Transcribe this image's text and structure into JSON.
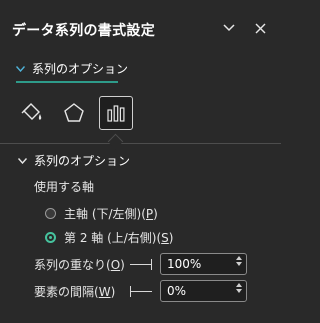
{
  "pane": {
    "title": "データ系列の書式設定",
    "collapse_icon": "chevron-down-icon",
    "close_icon": "close-icon"
  },
  "tab": {
    "label": "系列のオプション",
    "accent_color": "#2e9b8a"
  },
  "icon_tabs": [
    {
      "name": "fill-line-icon",
      "selected": false
    },
    {
      "name": "effects-pentagon-icon",
      "selected": false
    },
    {
      "name": "series-options-bar-chart-icon",
      "selected": true
    }
  ],
  "section": {
    "title": "系列のオプション",
    "axis_label": "使用する軸",
    "primary": {
      "label": "主軸 (下/左側)(",
      "key": "P",
      "suffix": ")",
      "selected": false
    },
    "secondary": {
      "label": "第 2 軸 (上/右側)(",
      "key": "S",
      "suffix": ")",
      "selected": true
    }
  },
  "overlap": {
    "label": "系列の重なり(",
    "key": "O",
    "suffix": ")",
    "value": "100%"
  },
  "gap": {
    "label": "要素の間隔(",
    "key": "W",
    "suffix": ")",
    "value": "0%"
  }
}
